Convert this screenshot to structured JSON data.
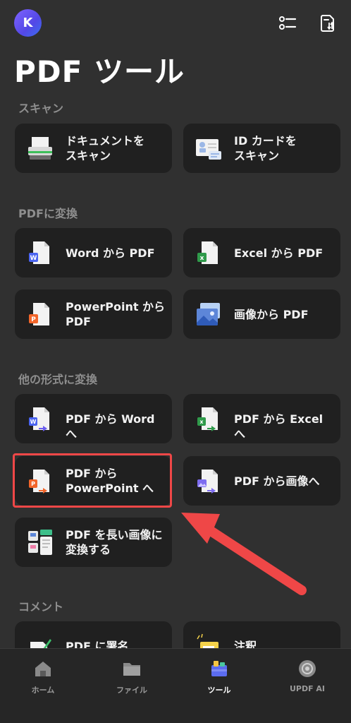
{
  "header": {
    "avatar_letter": "K",
    "title": "PDF ツール",
    "icons": [
      "list-icon",
      "sort-icon"
    ]
  },
  "sections": {
    "scan": {
      "label": "スキャン",
      "items": [
        "ドキュメントを\nスキャン",
        "ID カードを\nスキャン"
      ]
    },
    "to_pdf": {
      "label": "PDFに変換",
      "items": [
        "Word から PDF",
        "Excel から PDF",
        "PowerPoint から\nPDF",
        "画像から PDF"
      ]
    },
    "convert": {
      "label": "他の形式に変換",
      "items": [
        "PDF から Word へ",
        "PDF から Excel へ",
        "PDF から\nPowerPoint へ",
        "PDF から画像へ",
        "PDF を長い画像に\n変換する"
      ]
    },
    "comment": {
      "label": "コメント",
      "items": [
        "PDF に署名",
        "注釈"
      ]
    }
  },
  "tabs": [
    "ホーム",
    "ファイル",
    "ツール",
    "UPDF AI"
  ],
  "active_tab": "ツール",
  "colors": {
    "background": "#303030",
    "card": "#202020",
    "highlight": "#ef4747",
    "word": "#4a64f0",
    "excel": "#2f9a4a",
    "powerpoint": "#f2652a"
  }
}
